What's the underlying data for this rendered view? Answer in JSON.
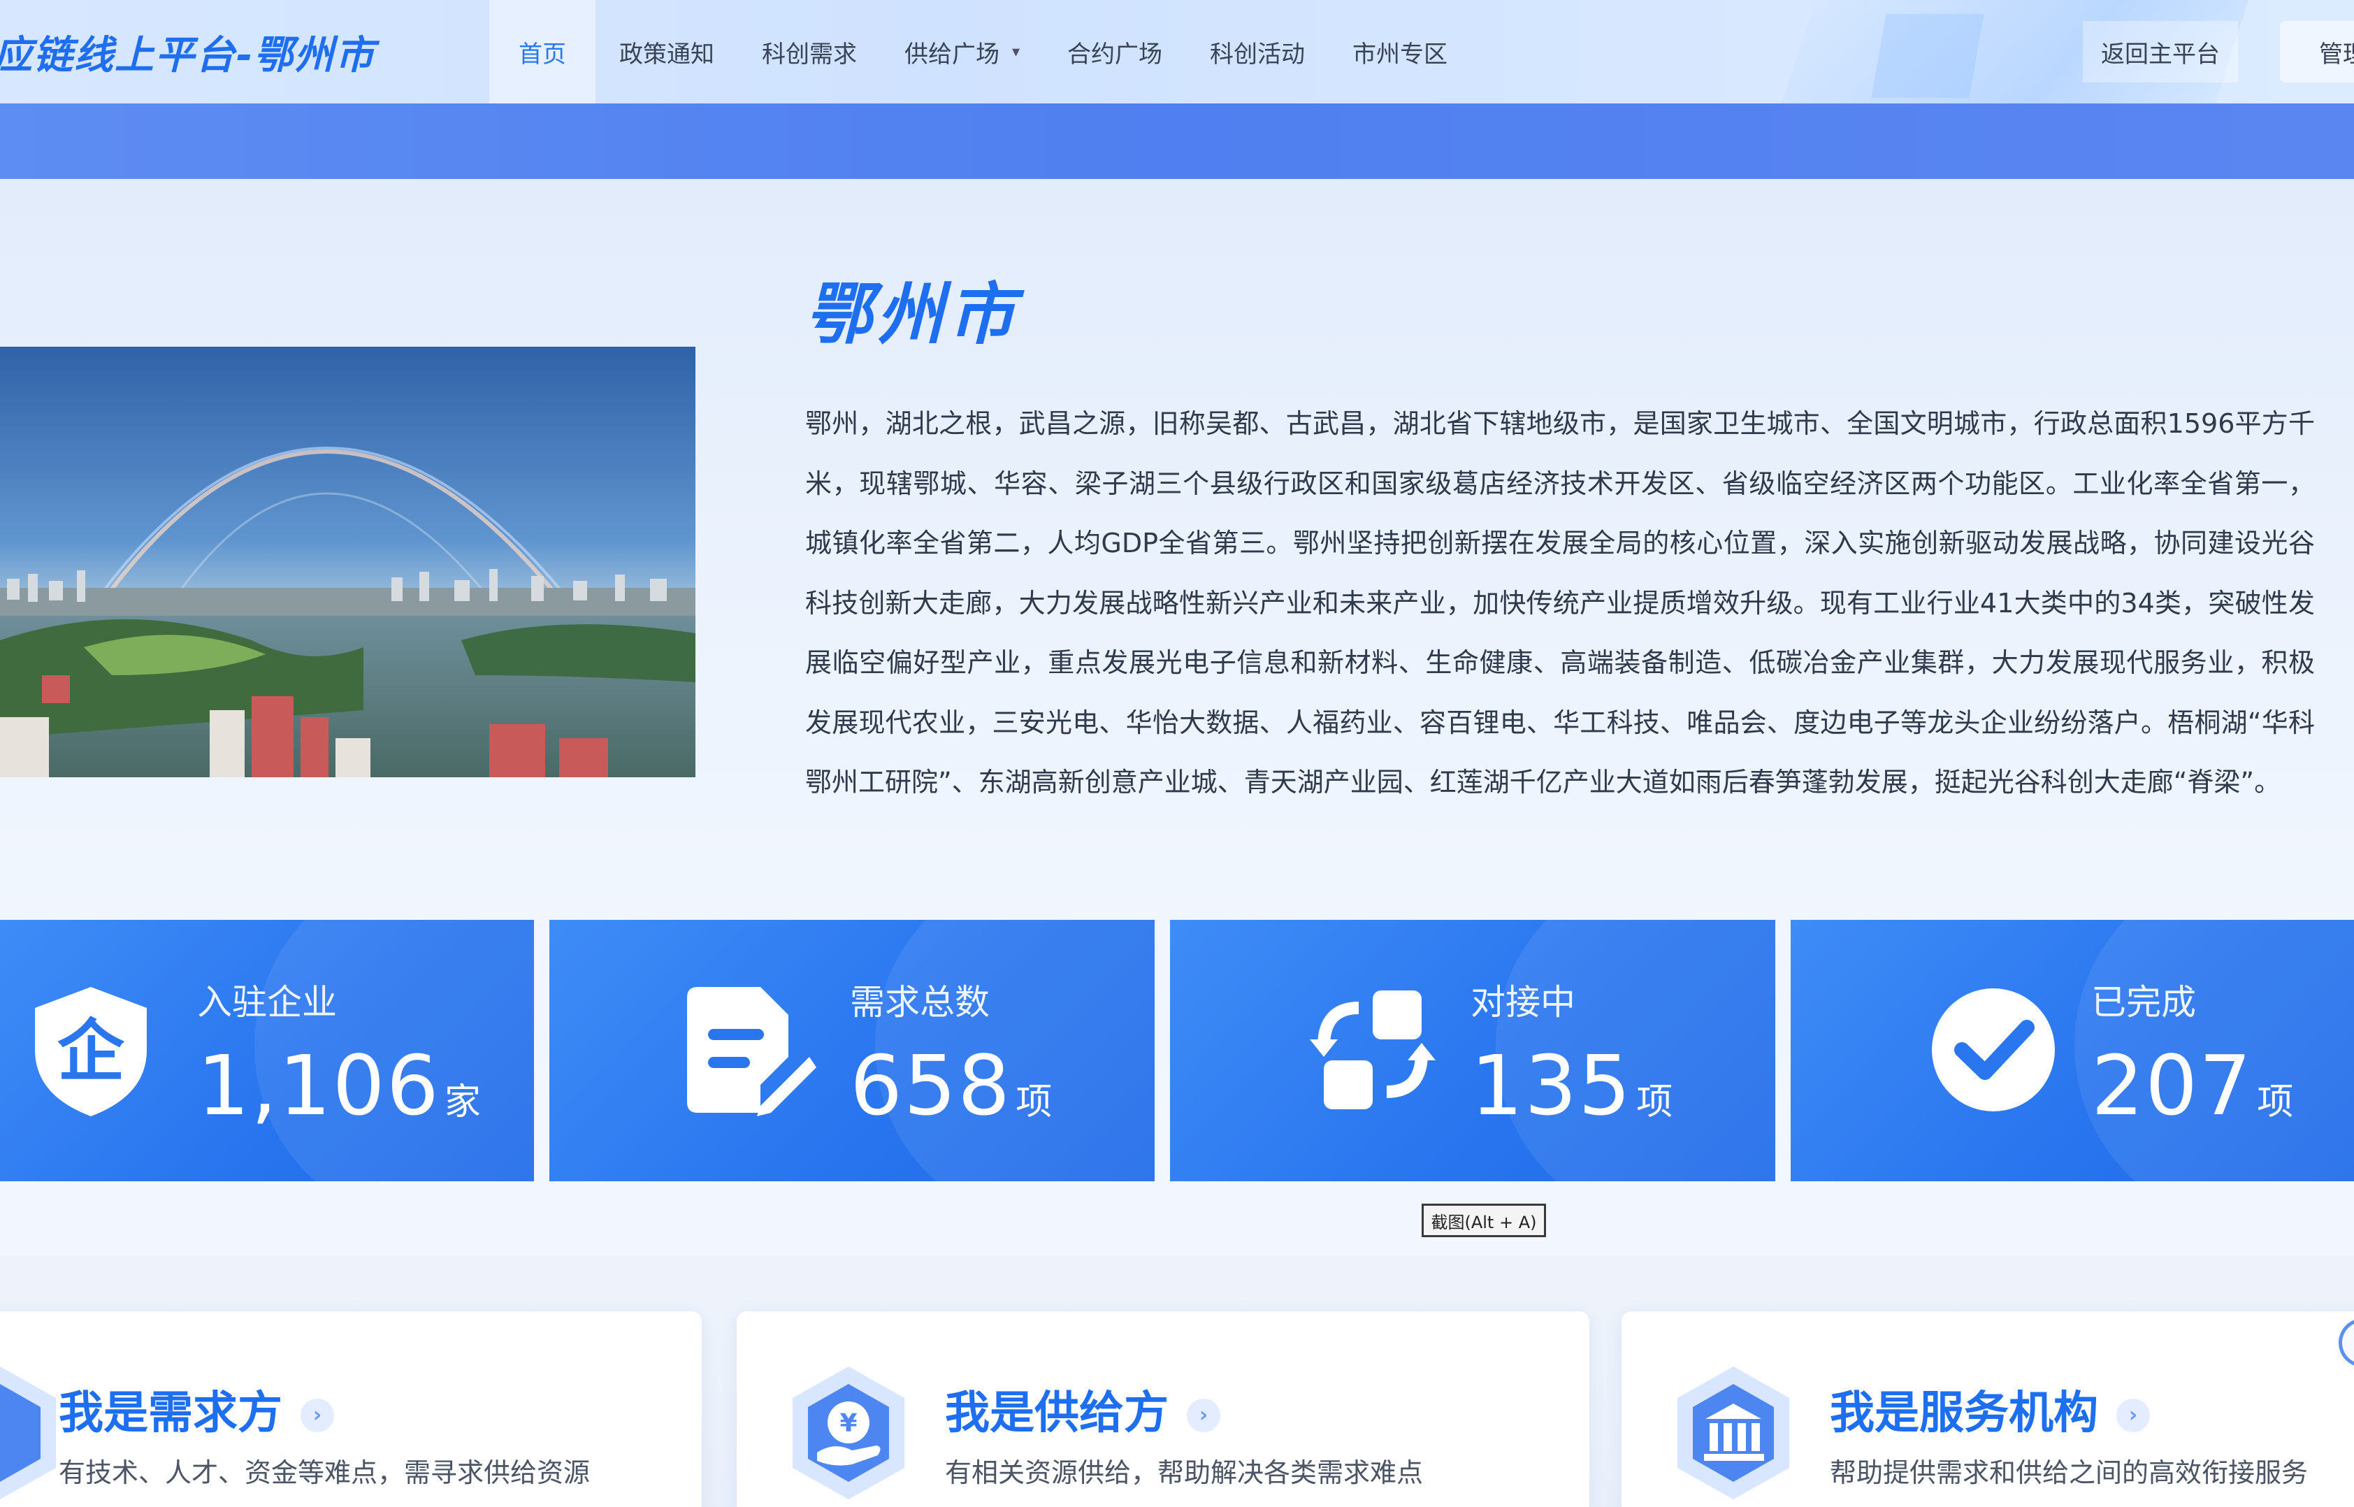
{
  "header": {
    "brand": "应链线上平台-鄂州市",
    "nav": [
      {
        "label": "首页",
        "active": true
      },
      {
        "label": "政策通知"
      },
      {
        "label": "科创需求"
      },
      {
        "label": "供给广场",
        "has_dropdown": true
      },
      {
        "label": "合约广场"
      },
      {
        "label": "科创活动"
      },
      {
        "label": "市州专区"
      }
    ],
    "return_label": "返回主平台",
    "admin_label": "管理"
  },
  "intro": {
    "city_name": "鄂州市",
    "description": "鄂州，湖北之根，武昌之源，旧称吴都、古武昌，湖北省下辖地级市，是国家卫生城市、全国文明城市，行政总面积1596平方千米，现辖鄂城、华容、梁子湖三个县级行政区和国家级葛店经济技术开发区、省级临空经济区两个功能区。工业化率全省第一，城镇化率全省第二，人均GDP全省第三。鄂州坚持把创新摆在发展全局的核心位置，深入实施创新驱动发展战略，协同建设光谷科技创新大走廊，大力发展战略性新兴产业和未来产业，加快传统产业提质增效升级。现有工业行业41大类中的34类，突破性发展临空偏好型产业，重点发展光电子信息和新材料、生命健康、高端装备制造、低碳冶金产业集群，大力发展现代服务业，积极发展现代农业，三安光电、华怡大数据、人福药业、容百锂电、华工科技、唯品会、度边电子等龙头企业纷纷落户。梧桐湖“华科鄂州工研院”、东湖高新创意产业城、青天湖产业园、红莲湖千亿产业大道如雨后春笋蓬勃发展，挺起光谷科创大走廊“脊梁”。"
  },
  "stats": [
    {
      "icon": "enterprise-shield-icon",
      "label": "入驻企业",
      "value": "1,106",
      "unit": "家"
    },
    {
      "icon": "document-edit-icon",
      "label": "需求总数",
      "value": "658",
      "unit": "项"
    },
    {
      "icon": "exchange-arrows-icon",
      "label": "对接中",
      "value": "135",
      "unit": "项"
    },
    {
      "icon": "check-circle-icon",
      "label": "已完成",
      "value": "207",
      "unit": "项"
    }
  ],
  "mini_tag": "截图(Alt + A)",
  "roles": [
    {
      "icon": "demand-icon",
      "title": "我是需求方",
      "subtitle": "有技术、人才、资金等难点，需寻求供给资源"
    },
    {
      "icon": "yuan-hand-icon",
      "title": "我是供给方",
      "subtitle": "有相关资源供给，帮助解决各类需求难点"
    },
    {
      "icon": "bank-icon",
      "title": "我是服务机构",
      "subtitle": "帮助提供需求和供给之间的高效衔接服务"
    }
  ],
  "colors": {
    "primary": "#1e6ff0",
    "band": "#5082f0",
    "card_blue": "#2a76ef"
  }
}
